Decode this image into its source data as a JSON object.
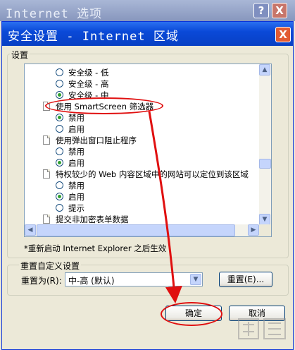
{
  "outer_window": {
    "title": "Internet 选项",
    "help": "?",
    "close": "X"
  },
  "underlying_buttons": {
    "ok": "确定",
    "cancel": "取消"
  },
  "dialog": {
    "title": "安全设置 - Internet 区域",
    "close": "X",
    "settings_group": "设置",
    "restart_note": "*重新启动 Internet Explorer 之后生效",
    "reset_group": "重置自定义设置",
    "reset_to_label": "重置为(R):",
    "reset_select_value": "中-高 (默认)",
    "reset_button": "重置(E)...",
    "ok_button": "确定",
    "cancel_button": "取消"
  },
  "settings_list": {
    "items": [
      {
        "type": "radio",
        "label": "安全级 - 低",
        "checked": false
      },
      {
        "type": "radio",
        "label": "安全级 - 高",
        "checked": false
      },
      {
        "type": "radio",
        "label": "安全级 - 中",
        "checked": true
      },
      {
        "type": "header",
        "label": "使用 SmartScreen 筛选器"
      },
      {
        "type": "radio",
        "label": "禁用",
        "checked": true
      },
      {
        "type": "radio",
        "label": "启用",
        "checked": false
      },
      {
        "type": "header",
        "label": "使用弹出窗口阻止程序"
      },
      {
        "type": "radio",
        "label": "禁用",
        "checked": false
      },
      {
        "type": "radio",
        "label": "启用",
        "checked": true
      },
      {
        "type": "header",
        "label": "特权较少的 Web 内容区域中的网站可以定位到该区域"
      },
      {
        "type": "radio",
        "label": "禁用",
        "checked": false
      },
      {
        "type": "radio",
        "label": "启用",
        "checked": true
      },
      {
        "type": "radio",
        "label": "提示",
        "checked": false
      },
      {
        "type": "header",
        "label": "提交非加密表单数据"
      }
    ]
  },
  "colors": {
    "annotation": "#e01010",
    "title_blue": "#0a49d8"
  }
}
